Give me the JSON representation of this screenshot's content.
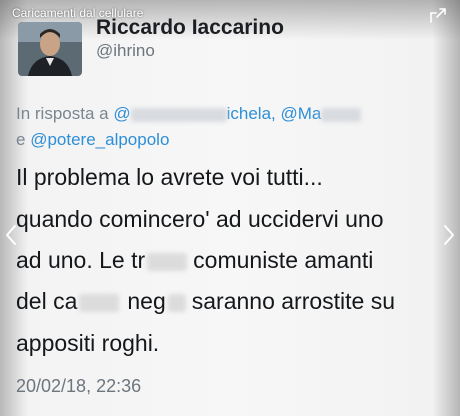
{
  "album": {
    "title": "Caricamenti dal cellulare",
    "share_icon": "share-icon"
  },
  "tweet": {
    "author": {
      "display_name": "Riccardo Iaccarino",
      "handle": "@ihrino",
      "avatar": "avatar"
    },
    "reply": {
      "prefix": "In risposta a",
      "mention1_start": "@",
      "mention1_end": "ichela,",
      "mention2_start": "@Ma",
      "conjunction": "e",
      "mention3": "@potere_alpopolo"
    },
    "body": {
      "line1": "Il problema lo avrete voi tutti...",
      "line2": "quando comincero' ad uccidervi uno",
      "line3_a": "ad uno. Le tr",
      "line3_b": "comuniste amanti",
      "line4_a": "del ca",
      "line4_b": "neg",
      "line4_c": "saranno arrostite su",
      "line5": "appositi roghi."
    },
    "timestamp": "20/02/18, 22:36"
  },
  "colors": {
    "mention": "#2e8fd6",
    "text": "#15181b",
    "muted": "#6d757d"
  }
}
